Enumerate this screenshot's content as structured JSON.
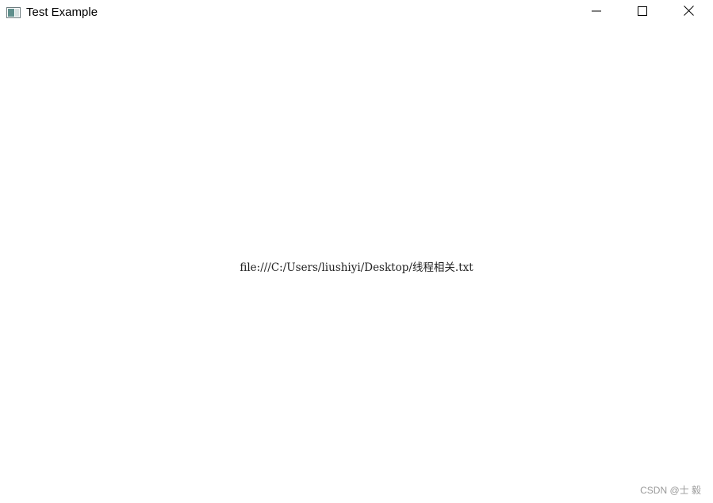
{
  "window": {
    "title": "Test Example",
    "controls": {
      "minimize_icon": "minimize-icon",
      "maximize_icon": "maximize-icon",
      "close_icon": "close-icon"
    }
  },
  "content": {
    "file_path": "file:///C:/Users/liushiyi/Desktop/线程相关.txt"
  },
  "watermark": {
    "text": "CSDN @士 毅"
  },
  "colors": {
    "background": "#ffffff",
    "text": "#222222",
    "watermark": "#9a9a9a"
  }
}
